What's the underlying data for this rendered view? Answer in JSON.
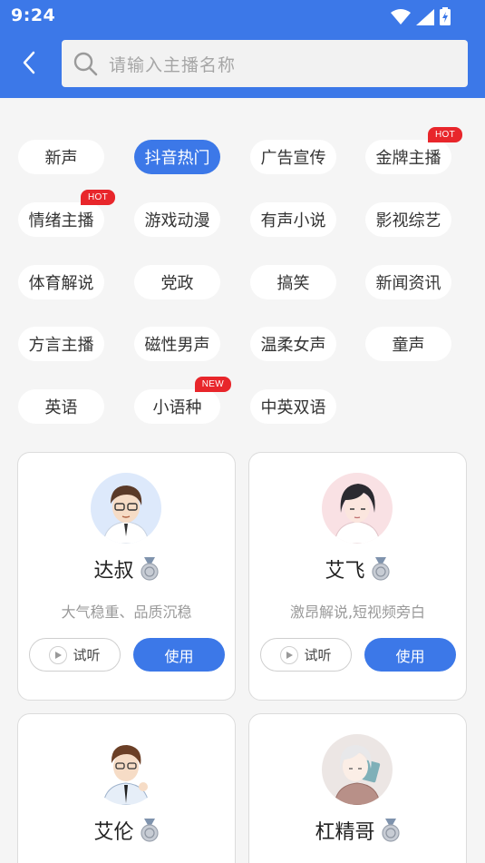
{
  "status_bar": {
    "time": "9:24",
    "wifi_icon": "wifi-icon",
    "signal_icon": "signal-icon",
    "battery_icon": "battery-icon"
  },
  "header": {
    "back_icon": "chevron-left-icon",
    "search_icon": "search-icon",
    "search_placeholder": "请输入主播名称"
  },
  "colors": {
    "brand_blue": "#3c78e8",
    "badge_red": "#e8262b",
    "page_bg": "#f5f5f5"
  },
  "categories": [
    {
      "label": "新声"
    },
    {
      "label": "抖音热门",
      "selected": true
    },
    {
      "label": "广告宣传"
    },
    {
      "label": "金牌主播",
      "badge": "HOT"
    },
    {
      "label": "情绪主播",
      "badge": "HOT"
    },
    {
      "label": "游戏动漫"
    },
    {
      "label": "有声小说"
    },
    {
      "label": "影视综艺"
    },
    {
      "label": "体育解说"
    },
    {
      "label": "党政"
    },
    {
      "label": "搞笑"
    },
    {
      "label": "新闻资讯"
    },
    {
      "label": "方言主播"
    },
    {
      "label": "磁性男声"
    },
    {
      "label": "温柔女声"
    },
    {
      "label": "童声"
    },
    {
      "label": "英语"
    },
    {
      "label": "小语种",
      "badge": "NEW"
    },
    {
      "label": "中英双语"
    }
  ],
  "anchors": [
    {
      "name": "达叔",
      "desc": "大气稳重、品质沉稳",
      "listen_label": "试听",
      "use_label": "使用",
      "medal_icon": "silver-medal-icon"
    },
    {
      "name": "艾飞",
      "desc": "激昂解说,短视频旁白",
      "listen_label": "试听",
      "use_label": "使用",
      "medal_icon": "silver-medal-icon"
    },
    {
      "name": "艾伦",
      "medal_icon": "silver-medal-icon"
    },
    {
      "name": "杠精哥",
      "medal_icon": "silver-medal-icon"
    }
  ]
}
